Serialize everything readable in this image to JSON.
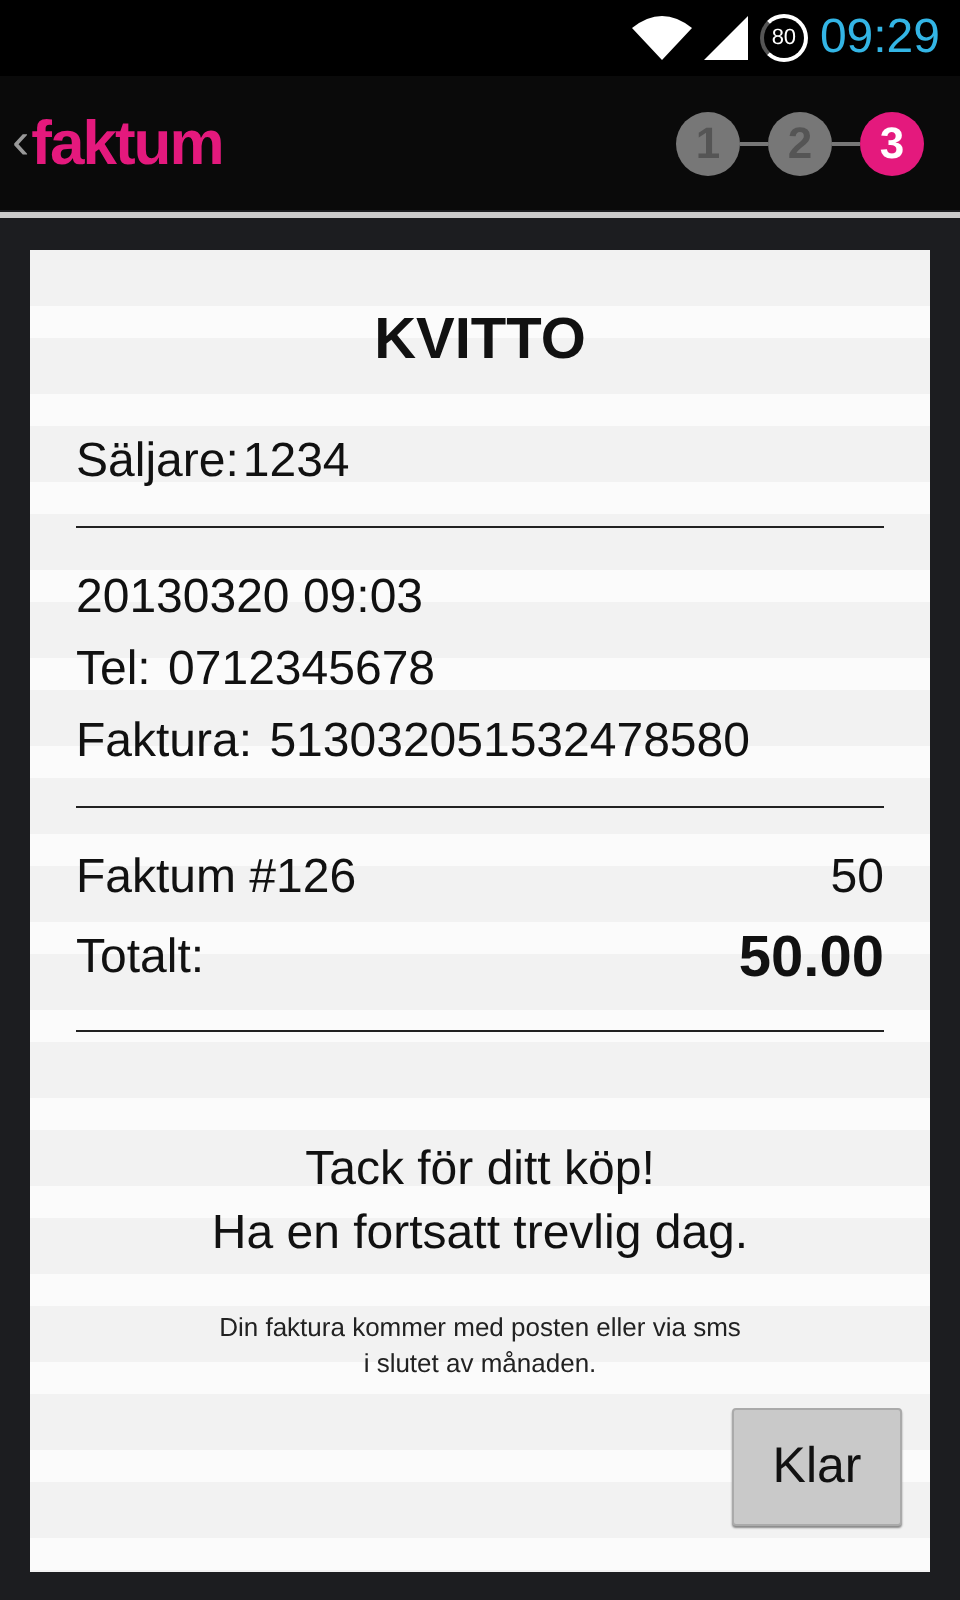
{
  "status_bar": {
    "battery": "80",
    "time": "09:29"
  },
  "header": {
    "back": "‹",
    "logo": "faktum",
    "steps": [
      {
        "label": "1",
        "selected": false
      },
      {
        "label": "2",
        "selected": false
      },
      {
        "label": "3",
        "selected": true
      }
    ]
  },
  "receipt": {
    "title": "KVITTO",
    "seller_label": "Säljare:",
    "seller": "1234",
    "date": "20130320 09:03",
    "phone_label": "Tel:",
    "phone": "0712345678",
    "invoice_label": "Faktura:",
    "invoice": "513032051532478580",
    "items": [
      {
        "name": "Faktum #126",
        "amount": "50"
      }
    ],
    "total_label": "Totalt:",
    "total": "50.00",
    "thanks": "Tack för ditt köp!\nHa en fortsatt trevlig dag.",
    "note": "Din faktura kommer med posten eller via sms\ni slutet av månaden."
  },
  "button": "Klar"
}
